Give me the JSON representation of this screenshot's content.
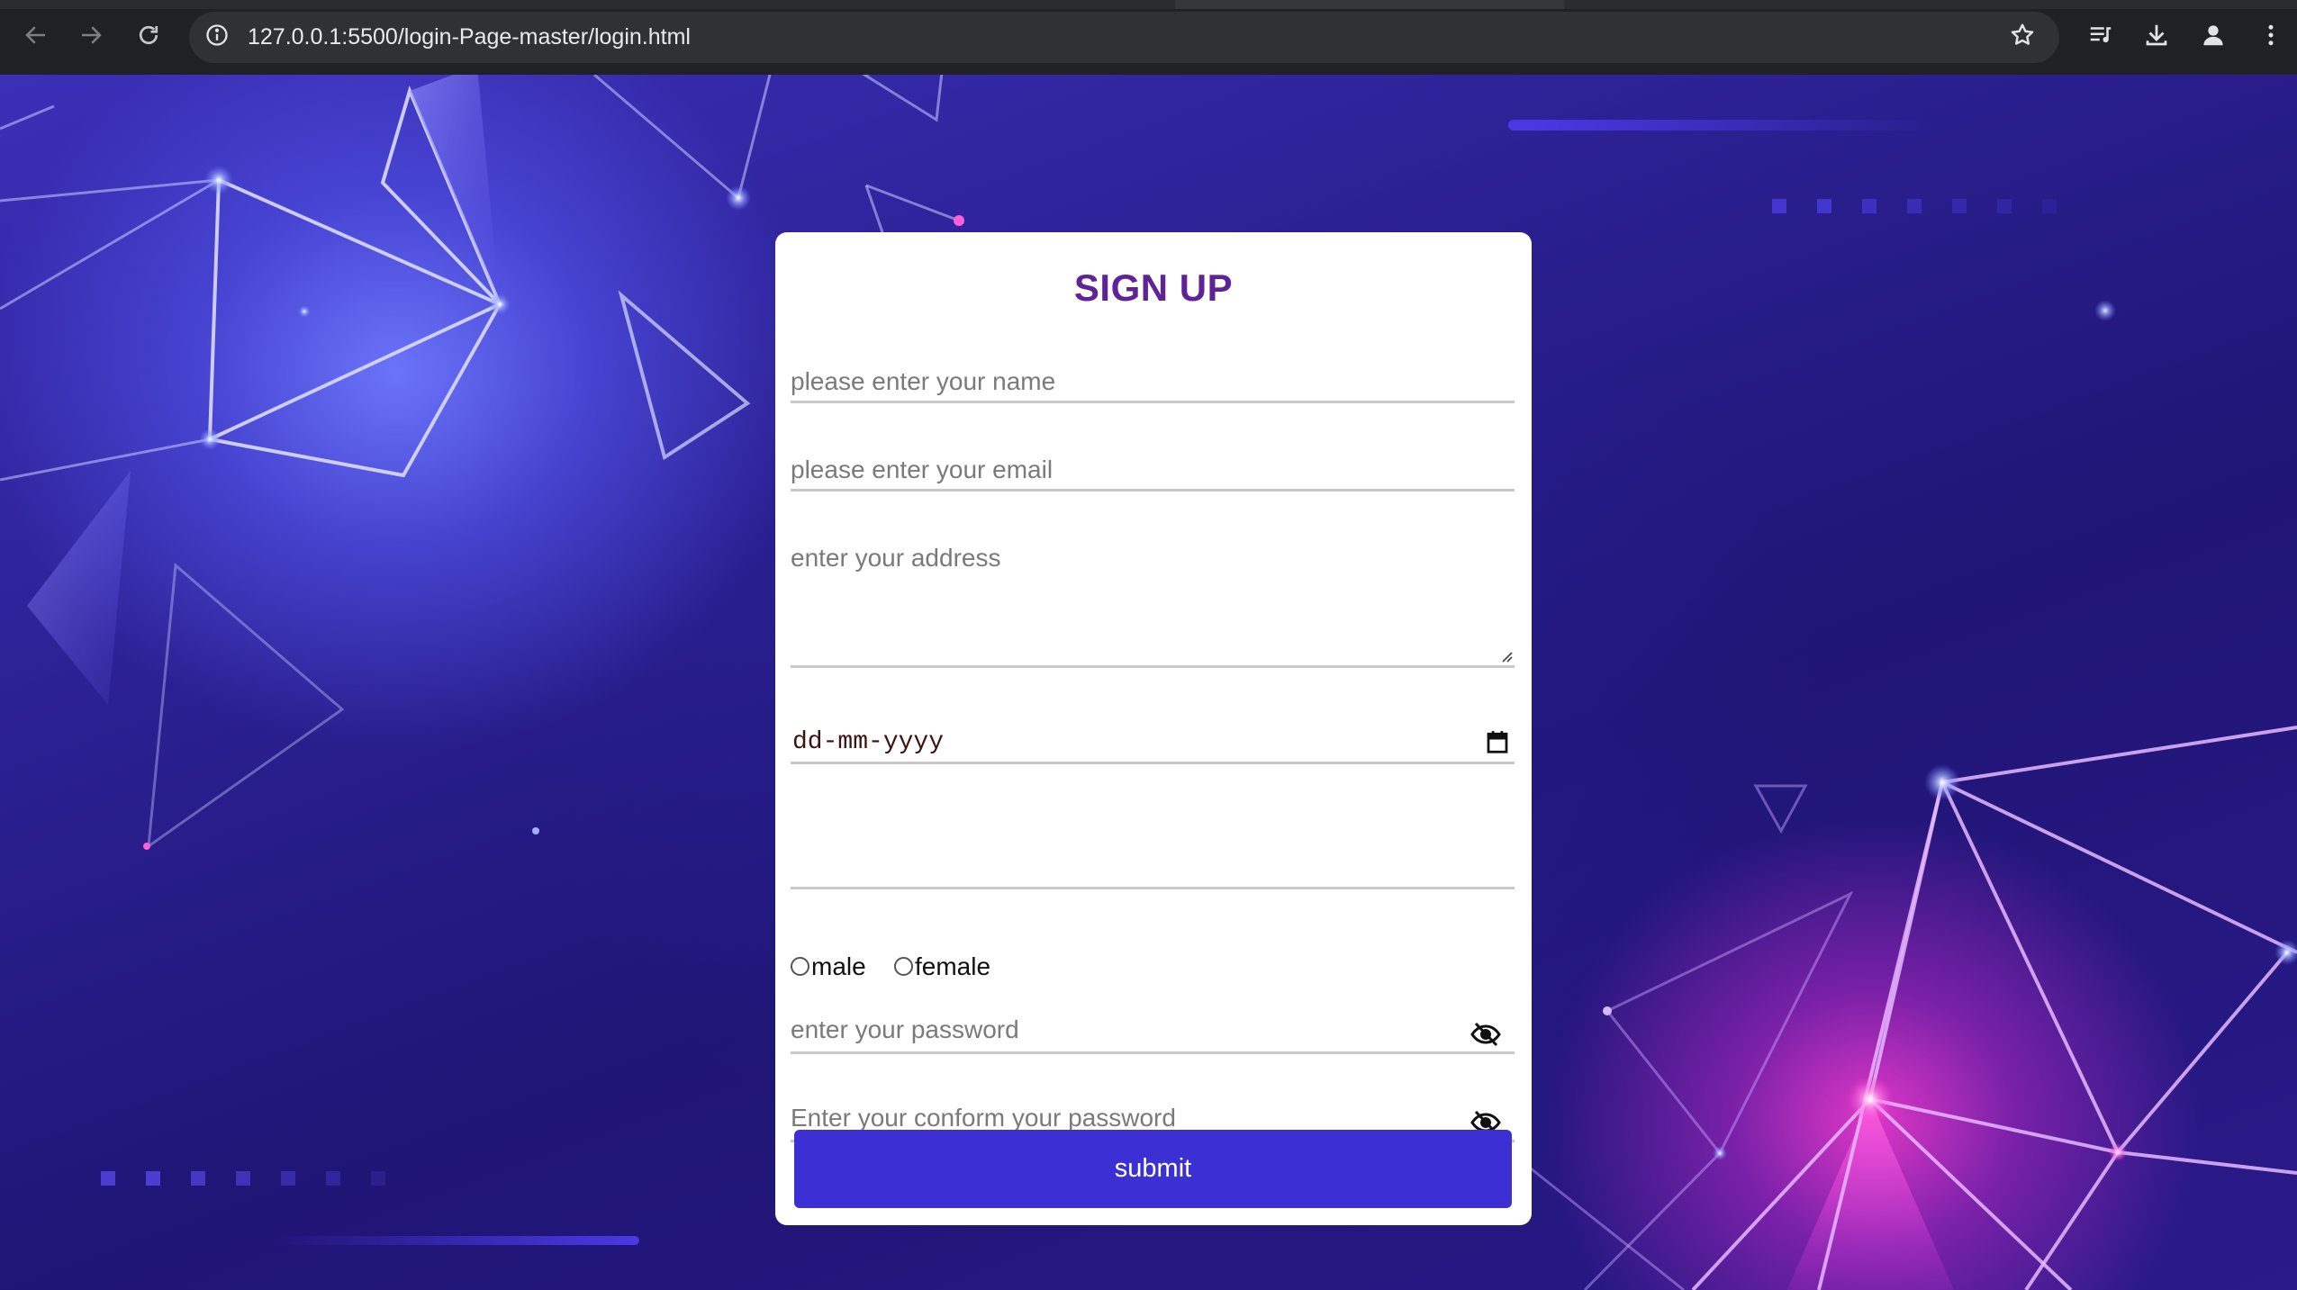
{
  "browser": {
    "url": "127.0.0.1:5500/login-Page-master/login.html"
  },
  "form": {
    "title": "SIGN UP",
    "name_placeholder": "please enter your name",
    "email_placeholder": "please enter your email",
    "address_placeholder": "enter your address",
    "date_placeholder": "dd-mm-yyyy",
    "gender_options": [
      {
        "label": "male",
        "checked": false
      },
      {
        "label": "female",
        "checked": false
      }
    ],
    "password_placeholder": "enter your password",
    "confirm_password_placeholder": "Enter your conform your password",
    "submit_label": "submit"
  },
  "icons": {
    "back": "arrow-left-icon",
    "forward": "arrow-right-icon",
    "reload": "reload-icon",
    "site_info": "info-circle-icon",
    "bookmark": "star-outline-icon",
    "media": "media-queue-icon",
    "download": "download-icon",
    "profile": "person-icon",
    "menu": "kebab-menu-icon",
    "calendar": "calendar-icon",
    "password_toggle": "eye-slash-icon"
  },
  "colors": {
    "title": "#5f2398",
    "submit_bg": "#3c2fd3",
    "page_bg_dark": "#1b1464",
    "accent_pink": "#ff3cd2",
    "accent_blue": "#6e78ff"
  }
}
